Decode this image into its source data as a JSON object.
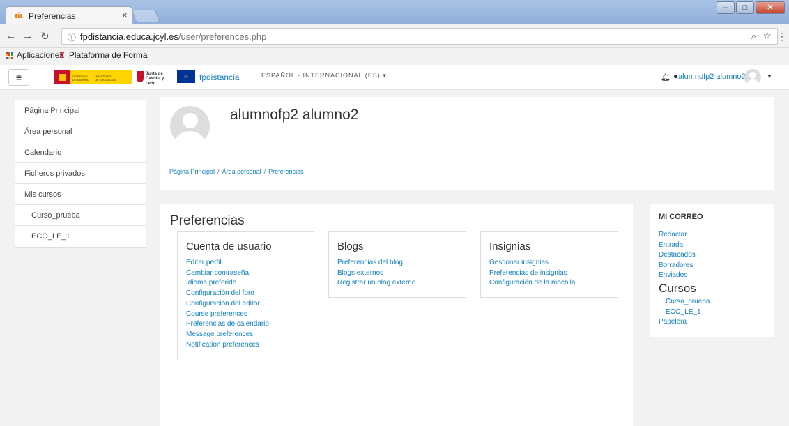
{
  "browser": {
    "tab_title": "Preferencias",
    "tab_icon": "moodle-icon",
    "tab_close": "×",
    "url_domain": "fpdistancia.educa.jcyl.es",
    "url_path": "/user/preferences.php",
    "bookmarks": [
      "Aplicaciones",
      "Plataforma de Forma"
    ]
  },
  "navbar": {
    "site_name": "fpdistancia",
    "language": "ESPAÑOL - INTERNACIONAL (ES) ▾",
    "username": "alumnofp2 alumno2"
  },
  "leftnav": {
    "items": [
      "Página Principal",
      "Área personal",
      "Calendario",
      "Ficheros privados",
      "Mis cursos",
      "Curso_prueba",
      "ECO_LE_1"
    ]
  },
  "header": {
    "fullname": "alumnofp2 alumno2",
    "breadcrumb": [
      "Página Principal",
      "Área personal",
      "Preferencias"
    ],
    "separator": "/"
  },
  "main": {
    "title": "Preferencias",
    "cards": [
      {
        "title": "Cuenta de usuario",
        "links": [
          "Editar perfil",
          "Cambiar contraseña",
          "Idioma preferido",
          "Configuración del foro",
          "Configuración del editor",
          "Course preferences",
          "Preferencias de calendario",
          "Message preferences",
          "Notification preferences"
        ]
      },
      {
        "title": "Blogs",
        "links": [
          "Preferencias del blog",
          "Blogs externos",
          "Registrar un blog externo"
        ]
      },
      {
        "title": "Insignias",
        "links": [
          "Gestionar insignias",
          "Preferencias de insignias",
          "Configuración de la mochila"
        ]
      }
    ]
  },
  "mail_block": {
    "title": "MI CORREO",
    "links": [
      "Redactar",
      "Entrada",
      "Destacados",
      "Borradores",
      "Enviados"
    ],
    "courses_heading": "Cursos",
    "courses": [
      "Curso_prueba",
      "ECO_LE_1"
    ],
    "trash": "Papelera"
  },
  "colors": {
    "link": "#0f7fc4",
    "background": "#f2f2f2",
    "card": "#ffffff"
  }
}
